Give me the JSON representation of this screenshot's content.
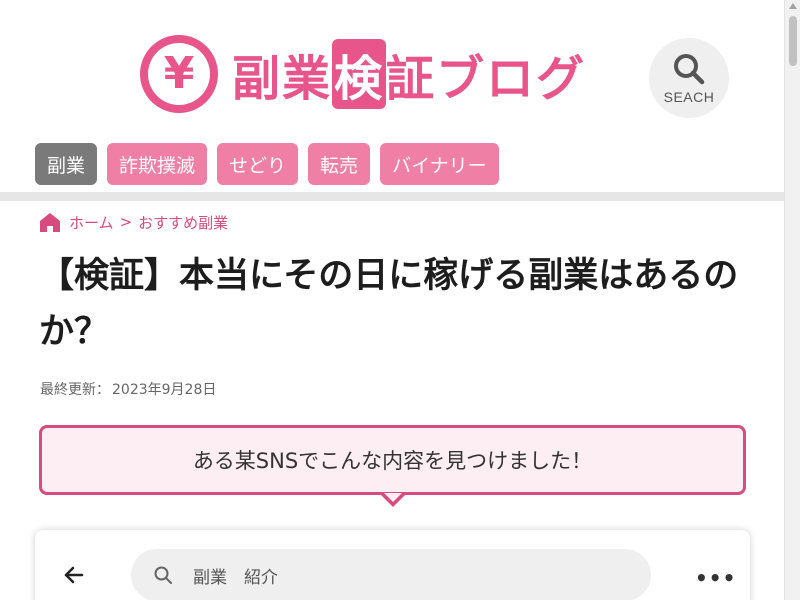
{
  "header": {
    "logo_symbol": "¥",
    "logo_text_part1": "副業",
    "logo_text_highlight": "検",
    "logo_text_part2": "証ブログ",
    "search_label": "SEACH",
    "brand_color": "#e8558a"
  },
  "nav": {
    "items": [
      {
        "label": "副業",
        "active": true
      },
      {
        "label": "詐欺撲滅",
        "active": false
      },
      {
        "label": "せどり",
        "active": false
      },
      {
        "label": "転売",
        "active": false
      },
      {
        "label": "バイナリー",
        "active": false
      }
    ],
    "active_color": "#7a7a7a",
    "item_color": "#ef7fa5"
  },
  "breadcrumb": {
    "home": "ホーム",
    "separator": ">",
    "category": "おすすめ副業"
  },
  "article": {
    "title": "【検証】本当にその日に稼げる副業はあるのか？",
    "updated_label": "最終更新：",
    "updated_date": "2023年9月28日",
    "speech_text": "ある某SNSでこんな内容を見つけました！"
  },
  "sns": {
    "search_text": "副業　紹介",
    "more": "•••"
  },
  "icons": {
    "home": "home-icon",
    "search": "search-icon",
    "back": "arrow-left-icon",
    "more": "more-horizontal-icon"
  }
}
